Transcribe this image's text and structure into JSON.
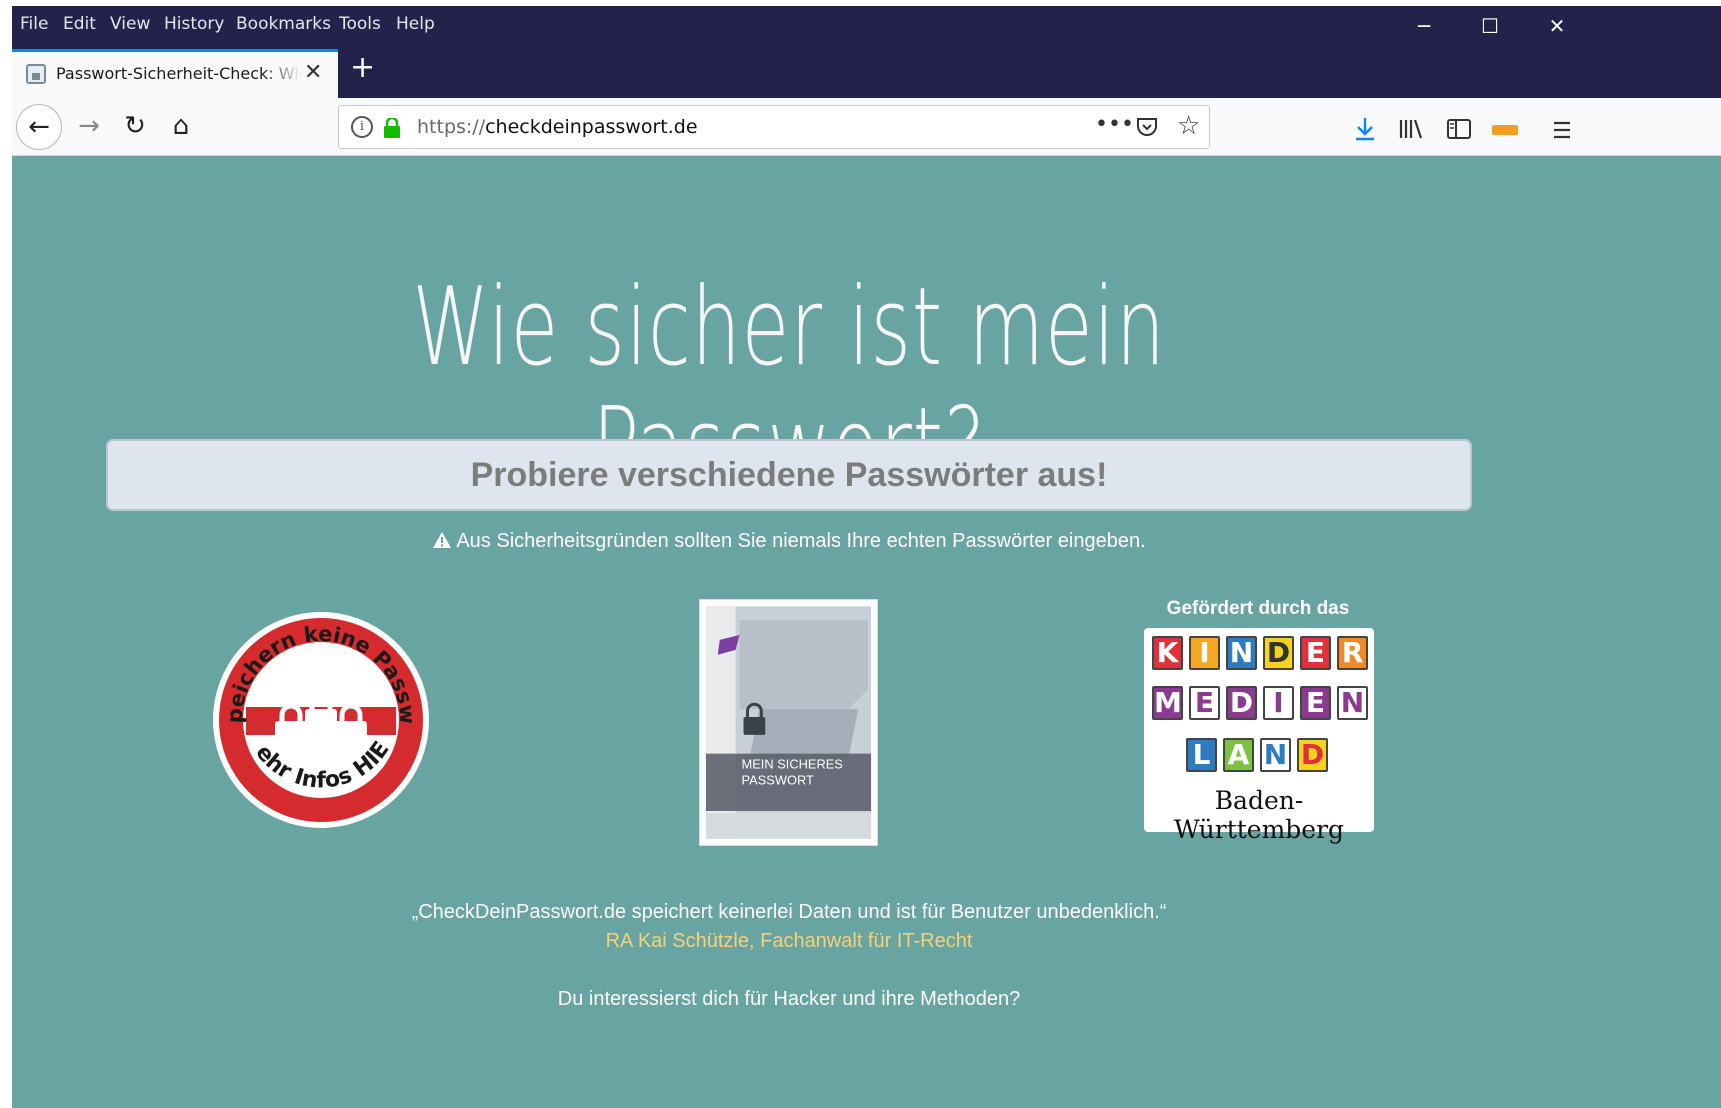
{
  "menu": {
    "file": "File",
    "edit": "Edit",
    "view": "View",
    "history": "History",
    "bookmarks": "Bookmarks",
    "tools": "Tools",
    "help": "Help"
  },
  "window_controls": {
    "minimize": "─",
    "maximize": "☐",
    "close": "✕"
  },
  "tab": {
    "title": "Passwort-Sicherheit-Check: Wie sicher ist mein Passwort?",
    "close": "✕",
    "new_tab": "+"
  },
  "nav": {
    "back": "←",
    "forward": "→",
    "reload": "↻",
    "home": "⌂"
  },
  "url": {
    "protocol": "https://",
    "host": "checkdeinpasswort.de",
    "more_actions": "•••",
    "bookmark_star": "☆"
  },
  "page": {
    "heading": "Wie sicher ist mein Passwort?",
    "input_placeholder": "Probiere verschiedene Passwörter aus!",
    "warning": "Aus Sicherheitsgründen sollten Sie niemals Ihre echten Passwörter eingeben.",
    "badge": {
      "top_text": "Wir speichern keine Passwörter",
      "bottom_text": "Mehr Infos HIER"
    },
    "book": {
      "title_line1": "MEIN SICHERES",
      "title_line2": "PASSWORT"
    },
    "sponsor": {
      "caption": "Gefördert durch das",
      "row1": [
        "K",
        "I",
        "N",
        "D",
        "E",
        "R"
      ],
      "row2": [
        "M",
        "E",
        "D",
        "I",
        "E",
        "N"
      ],
      "row3": [
        "L",
        "A",
        "N",
        "D"
      ],
      "region": "Baden-Württemberg"
    },
    "quote": "„CheckDeinPasswort.de speichert keinerlei Daten und ist für Benutzer unbedenklich.“",
    "quote_author": "RA Kai Schützle, Fachanwalt für IT-Recht",
    "hacker_line": "Du interessierst dich für Hacker und ihre Methoden?"
  },
  "colors": {
    "page_background": "#68a4a2",
    "chrome_dark": "#22224a",
    "badge_red": "#d52a2e",
    "author_gold": "#f4d27a",
    "accent_blue": "#0a84ff"
  }
}
